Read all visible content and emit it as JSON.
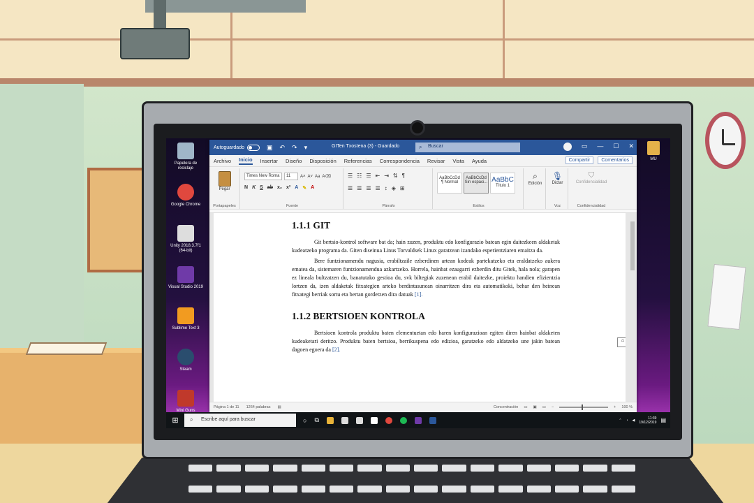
{
  "desktop": {
    "icons_left": [
      {
        "label": "Papelera de reciclaje",
        "color": "#9fb6c8"
      },
      {
        "label": "Google Chrome",
        "color": "#e0483e"
      },
      {
        "label": "Unity 2018.3.7f1 (64-bit)",
        "color": "#dddddd"
      },
      {
        "label": "Visual Studio 2019",
        "color": "#6f3aa8"
      },
      {
        "label": "Sublime Text 3",
        "color": "#f29b20"
      },
      {
        "label": "Steam",
        "color": "#2a4d6e"
      },
      {
        "label": "Mini Guns",
        "color": "#c0392b"
      }
    ],
    "icon_right": {
      "label": "MU"
    }
  },
  "word": {
    "autosave_label": "Autoguardado",
    "doc_title": "GITen Txostena (3) - Guardado",
    "search_placeholder": "Buscar",
    "tabs": [
      "Archivo",
      "Inicio",
      "Insertar",
      "Diseño",
      "Disposición",
      "Referencias",
      "Correspondencia",
      "Revisar",
      "Vista",
      "Ayuda"
    ],
    "active_tab": "Inicio",
    "share_label": "Compartir",
    "comments_label": "Comentarios",
    "ribbon": {
      "paste_label": "Pegar",
      "clipboard_label": "Portapapeles",
      "font_name": "Times New Roma",
      "font_size": "11",
      "font_group_label": "Fuente",
      "paragraph_label": "Párrafo",
      "styles": [
        {
          "preview": "AaBbCcDd",
          "name": "¶ Normal"
        },
        {
          "preview": "AaBbCcDd",
          "name": "Sin espaci..."
        },
        {
          "preview": "AaBbC",
          "name": "Título 1"
        }
      ],
      "styles_label": "Estilos",
      "edit_label": "Edición",
      "dictate_label": "Dictar",
      "voice_label": "Voz",
      "confidentiality_btn": "Confidencialidad",
      "confidentiality_label": "Confidencialidad"
    },
    "document": {
      "h1": "1.1.1 GIT",
      "p1": "Git bertsio-kontrol software bat da; hain zuzen, produktu edo konfigurazio batean egin daitezkeen aldaketak kudeatzeko programa da. Giten diseinua Linus Torvaldsek Linux garatzean izandako esperientziaren emaitza da.",
      "p2": "Bere funtzionamendu nagusia, erabiltzaile ezberdinen artean kodeak partekatzeko eta eraldatzeko aukera ematea da, sistemaren funtzionamendua azkartzeko. Horrela, hainbat ezaugarri ezberdin ditu Gitek, hala nola; garapen ez lineala bultzatzen du, banatutako gestioa du, svk biltegiak zuzenean erabil daitezke, proiektu handien efizientzia lortzen da, izen aldaketak fitxategien arteko berdintasunean oinarritzen dira eta automatikoki, behar den heinean fitxategi berriak sortu eta bertan gordetzen dira datuak",
      "p2_ref": "[1].",
      "h2": "1.1.2 BERTSIOEN KONTROLA",
      "p3": "Bertsioen kontrola produktu baten elementuetan edo haren konfigurazioan egiten diren hainbat aldaketen kudeaketari deritzo. Produktu baten bertsioa, berrikuspena edo edizioa, garatzeko edo aldatzeko une jakin batean dagoen egoera da",
      "p3_ref": "[2]."
    },
    "status": {
      "page": "Página 1 de 11",
      "words": "1264 palabras",
      "focus": "Concentración",
      "zoom": "100 %"
    }
  },
  "taskbar": {
    "search_placeholder": "Escribe aquí para buscar",
    "time": "11:39",
    "date": "19/12/2019",
    "apps": [
      "#ffffff",
      "#e8b339",
      "#3a87d8",
      "#dddddd",
      "#dddddd",
      "#e0483e",
      "#1db954",
      "#6f3aa8",
      "#2b579a"
    ]
  }
}
